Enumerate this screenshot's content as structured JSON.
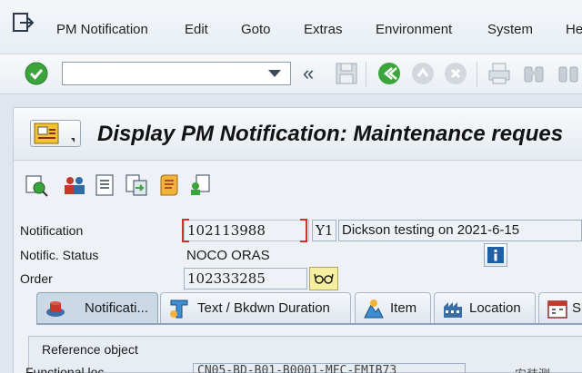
{
  "menubar": {
    "items": [
      "PM Notification",
      "Edit",
      "Goto",
      "Extras",
      "Environment",
      "System",
      "He"
    ]
  },
  "toolbar": {
    "command_field_value": "",
    "back_label": "«"
  },
  "title": {
    "text": "Display PM Notification: Maintenance reques"
  },
  "form": {
    "notification_label": "Notification",
    "notification_number": "102113988",
    "notification_type": "Y1",
    "notification_desc": "Dickson testing on 2021-6-15",
    "status_label": "Notific. Status",
    "status_value": "NOCO ORAS",
    "order_label": "Order",
    "order_value": "102333285"
  },
  "tabs": [
    {
      "label": "Notificati...",
      "icon": "notification-icon",
      "active": true
    },
    {
      "label": "Text / Bkdwn Duration",
      "icon": "text-icon",
      "active": false
    },
    {
      "label": "Item",
      "icon": "item-icon",
      "active": false
    },
    {
      "label": "Location",
      "icon": "location-icon",
      "active": false
    },
    {
      "label": "S",
      "icon": "schedule-icon",
      "active": false
    }
  ],
  "panel": {
    "group_title": "Reference object",
    "functional_loc_label": "Functional loc.",
    "functional_loc_value": "CN05-BD-B01-B0001-MFC-EMIB73",
    "extra_text": "安装测"
  },
  "colors": {
    "accept": "#3aa53a",
    "focus_red": "#d23030",
    "tab_active": "#cbd9e7"
  }
}
